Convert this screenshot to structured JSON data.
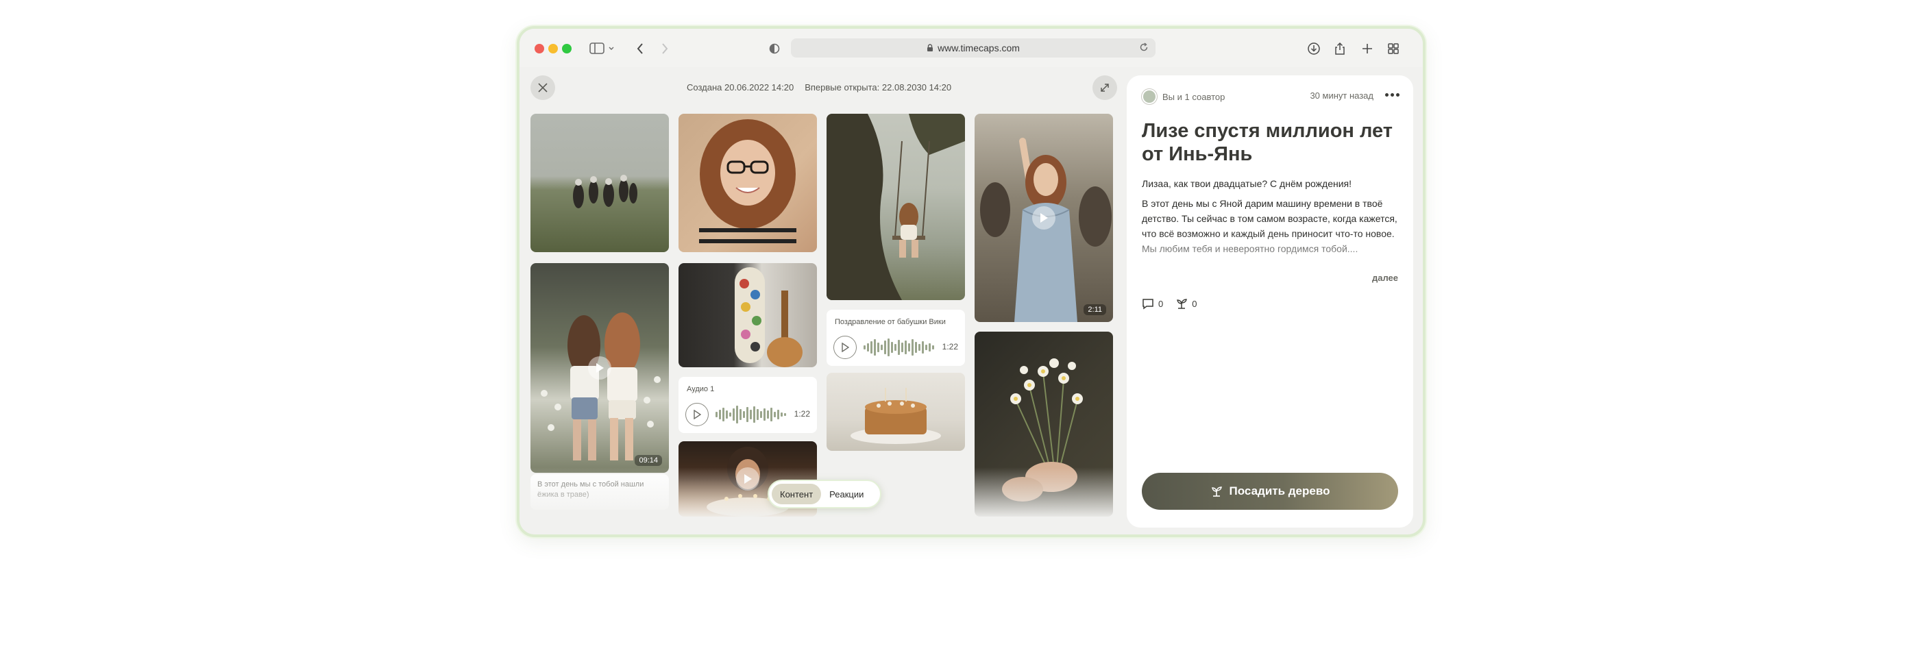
{
  "browser": {
    "url": "www.timecaps.com"
  },
  "capsule": {
    "created": "Создана 20.06.2022 14:20",
    "first_opened": "Впервые открыта: 22.08.2030 14:20"
  },
  "grid": {
    "video1_duration": "09:14",
    "video2_duration": "2:11",
    "caption1": "В этот день мы с тобой нашли ёжика в траве)",
    "audio1_title": "Аудио 1",
    "audio1_time": "1:22",
    "audio2_title": "Поздравление от бабушки Вики",
    "audio2_time": "1:22"
  },
  "tabs": {
    "content": "Контент",
    "reactions": "Реакции"
  },
  "panel": {
    "coauthors": "Вы и 1 соавтор",
    "time_ago": "30 минут назад",
    "title": "Лизе спустя миллион лет от Инь-Янь",
    "greeting": "Лизаа, как твои двадцатые? С днём рождения!",
    "body": "В этот день мы с Яной дарим машину времени в твоё детство. Ты сейчас в том самом возрасте, когда кажется, что всё возможно и каждый день приносит что-то новое. Мы любим тебя и невероятно гордимся тобой....",
    "more_label": "далее",
    "comments_count": "0",
    "trees_count": "0",
    "plant_button": "Посадить дерево"
  },
  "colors": {
    "window_border": "#dcebcf",
    "button_start": "#56574a",
    "button_end": "#a39a7a",
    "active_tab": "#dcd9c8"
  }
}
